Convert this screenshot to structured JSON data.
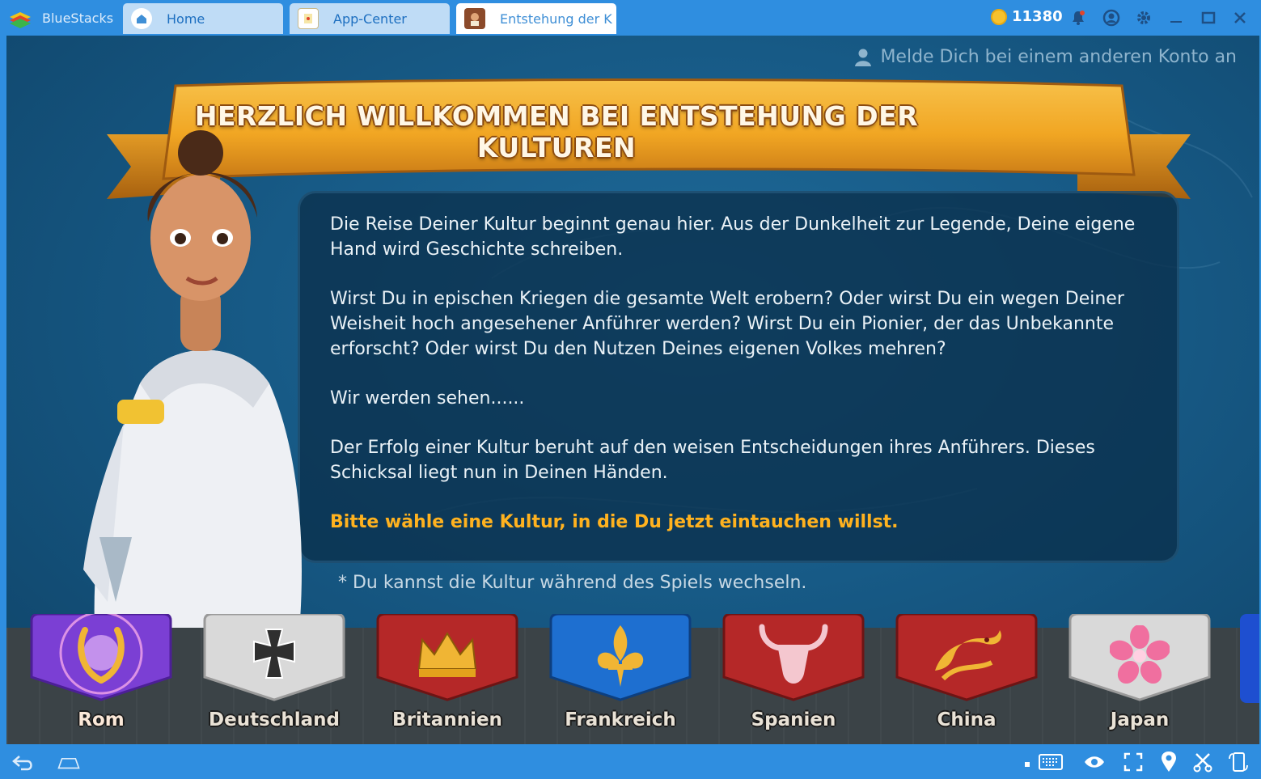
{
  "window": {
    "brand": "BlueStacks",
    "tabs": [
      {
        "label": "Home",
        "icon": "home-icon"
      },
      {
        "label": "App-Center",
        "icon": "app-center-icon"
      },
      {
        "label": "Entstehung der K",
        "icon": "game-icon"
      }
    ],
    "coins": "11380",
    "accent": "#2f8ee0"
  },
  "game": {
    "switch_account": "Melde Dich bei einem anderen Konto an",
    "banner_title": "HERZLICH WILLKOMMEN BEI ENTSTEHUNG DER KULTUREN",
    "paragraphs": [
      "Die Reise Deiner Kultur beginnt genau hier. Aus der Dunkelheit zur Legende, Deine eigene Hand wird Geschichte schreiben.",
      "Wirst Du in epischen Kriegen die gesamte Welt erobern? Oder wirst Du ein wegen Deiner Weisheit hoch angesehener Anführer werden? Wirst Du ein Pionier, der das Unbekannte erforscht? Oder wirst Du den Nutzen Deines eigenen Volkes mehren?",
      "Wir werden sehen......",
      "Der Erfolg einer Kultur beruht auf den weisen Entscheidungen ihres Anführers. Dieses Schicksal liegt nun in Deinen Händen."
    ],
    "call_to_action": "Bitte wähle eine Kultur, in die Du jetzt eintauchen willst.",
    "footnote": "* Du kannst die Kultur während des Spiels wechseln.",
    "cultures": [
      {
        "label": "Rom",
        "icon": "laurel-wreath-icon",
        "color": "#7b3fd4",
        "selected": true
      },
      {
        "label": "Deutschland",
        "icon": "iron-cross-icon",
        "color": "#d9d9d9",
        "selected": false
      },
      {
        "label": "Britannien",
        "icon": "crown-icon",
        "color": "#b52828",
        "selected": false
      },
      {
        "label": "Frankreich",
        "icon": "fleur-de-lis-icon",
        "color": "#1e6fd0",
        "selected": false
      },
      {
        "label": "Spanien",
        "icon": "bull-icon",
        "color": "#b52828",
        "selected": false
      },
      {
        "label": "China",
        "icon": "dragon-icon",
        "color": "#b52828",
        "selected": false
      },
      {
        "label": "Japan",
        "icon": "cherry-blossom-icon",
        "color": "#d9d9d9",
        "selected": false
      }
    ],
    "highlight_color": "#ffb21f"
  },
  "bottombar": {
    "icons": [
      "back-icon",
      "home-outline-icon",
      "keyboard-icon",
      "eye-icon",
      "fullscreen-icon",
      "location-icon",
      "scissors-icon",
      "phone-rotate-icon"
    ]
  }
}
